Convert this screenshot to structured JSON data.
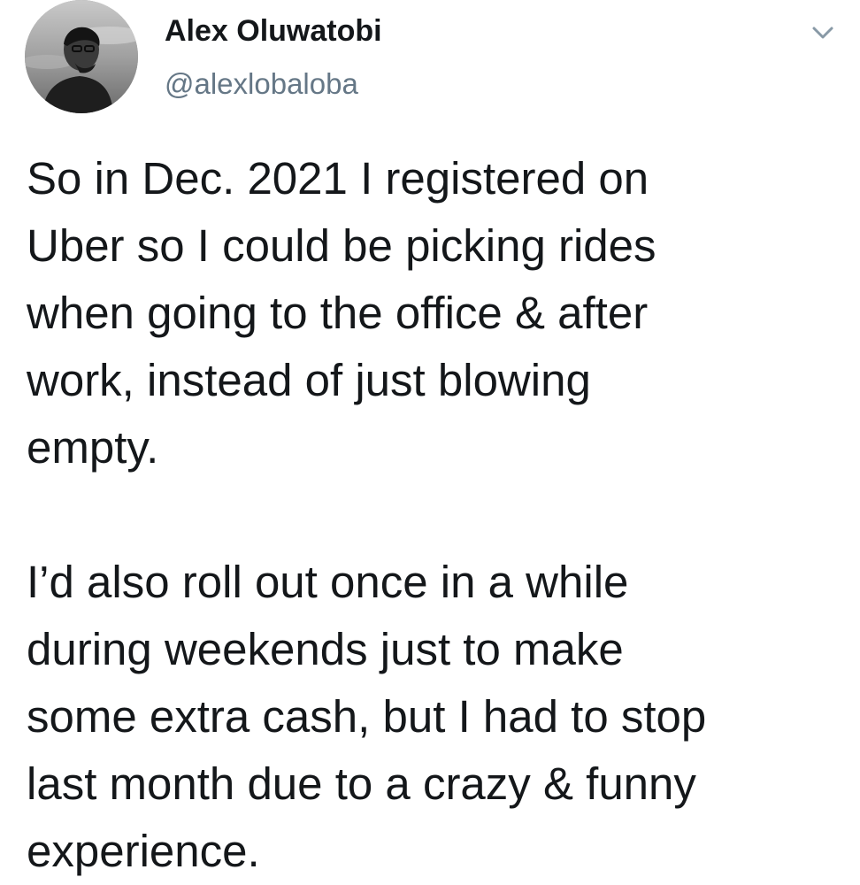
{
  "tweet": {
    "author": {
      "display_name": "Alex Oluwatobi",
      "handle": "@alexlobaloba",
      "avatar_icon": "profile-photo"
    },
    "menu_icon": "chevron-down-icon",
    "paragraphs": [
      "So in Dec. 2021 I registered on\nUber so I could be picking rides\nwhen going to the office & after\nwork, instead of just blowing\nempty.",
      "I’d also roll out once in a while\nduring weekends just to make\nsome extra cash, but I had to stop\nlast month due to a crazy & funny\nexperience."
    ]
  },
  "colors": {
    "text": "#14171a",
    "secondary_text": "#657786",
    "background": "#ffffff"
  }
}
